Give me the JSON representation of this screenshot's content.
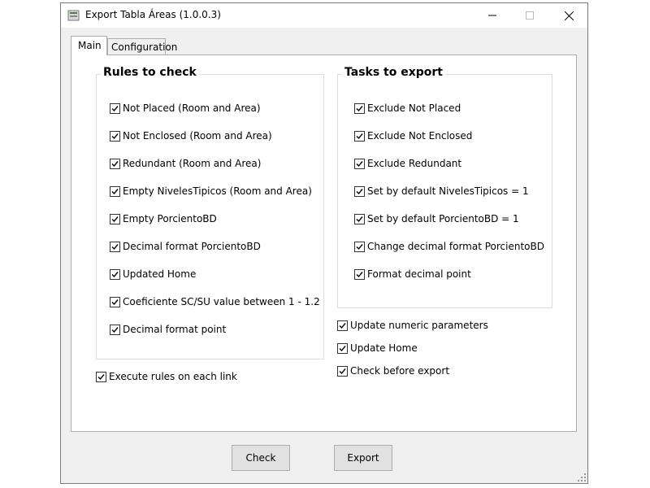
{
  "window": {
    "title": "Export Tabla Áreas (1.0.0.3)"
  },
  "tabs": [
    {
      "label": "Main"
    },
    {
      "label": "Configuration"
    }
  ],
  "rules": {
    "title": "Rules to check",
    "items": [
      {
        "label": "Not Placed (Room and Area)",
        "checked": true
      },
      {
        "label": "Not Enclosed (Room and Area)",
        "checked": true
      },
      {
        "label": "Redundant (Room and Area)",
        "checked": true
      },
      {
        "label": "Empty NivelesTipicos (Room and Area)",
        "checked": true
      },
      {
        "label": "Empty PorcientoBD",
        "checked": true
      },
      {
        "label": "Decimal format PorcientoBD",
        "checked": true
      },
      {
        "label": "Updated Home",
        "checked": true
      },
      {
        "label": "Coeficiente SC/SU value between 1 - 1.2",
        "checked": true
      },
      {
        "label": "Decimal format point",
        "checked": true
      }
    ]
  },
  "execute_each_link": {
    "label": "Execute rules on each link",
    "checked": true
  },
  "tasks": {
    "title": "Tasks to export",
    "items": [
      {
        "label": "Exclude Not Placed",
        "checked": true
      },
      {
        "label": "Exclude Not Enclosed",
        "checked": true
      },
      {
        "label": "Exclude Redundant",
        "checked": true
      },
      {
        "label": "Set by default NivelesTipicos = 1",
        "checked": true
      },
      {
        "label": "Set by default PorcientoBD = 1",
        "checked": true
      },
      {
        "label": "Change decimal format PorcientoBD",
        "checked": true
      },
      {
        "label": "Format decimal point",
        "checked": true
      }
    ]
  },
  "extra_options": [
    {
      "label": "Update numeric parameters",
      "checked": true
    },
    {
      "label": "Update Home",
      "checked": true
    },
    {
      "label": "Check before export",
      "checked": true
    }
  ],
  "buttons": {
    "check": "Check",
    "export": "Export"
  }
}
